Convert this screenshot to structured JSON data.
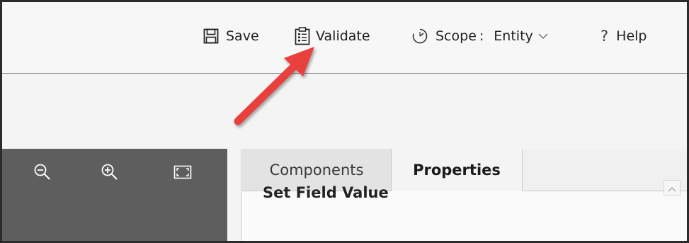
{
  "toolbar": {
    "save_label": "Save",
    "validate_label": "Validate",
    "scope_label": "Scope",
    "scope_separator": ":",
    "scope_value": "Entity",
    "help_label": "Help",
    "help_glyph": "?",
    "icons": {
      "save": "save-icon",
      "validate": "clipboard-checklist-icon",
      "scope": "scope-gauge-icon",
      "scope_dropdown": "chevron-down-icon",
      "help": "question-mark-icon"
    }
  },
  "zoom_toolbar": {
    "icons": [
      "zoom-out-icon",
      "zoom-in-icon",
      "fit-to-screen-icon"
    ]
  },
  "side_panel": {
    "tabs": [
      {
        "label": "Components",
        "selected": false
      },
      {
        "label": "Properties",
        "selected": true
      }
    ],
    "section_title": "Set Field Value"
  },
  "colors": {
    "annotation_arrow": "#e8413d",
    "zoom_panel_bg": "#5e5e5e",
    "command_bar_bg": "#f7f7f7"
  }
}
